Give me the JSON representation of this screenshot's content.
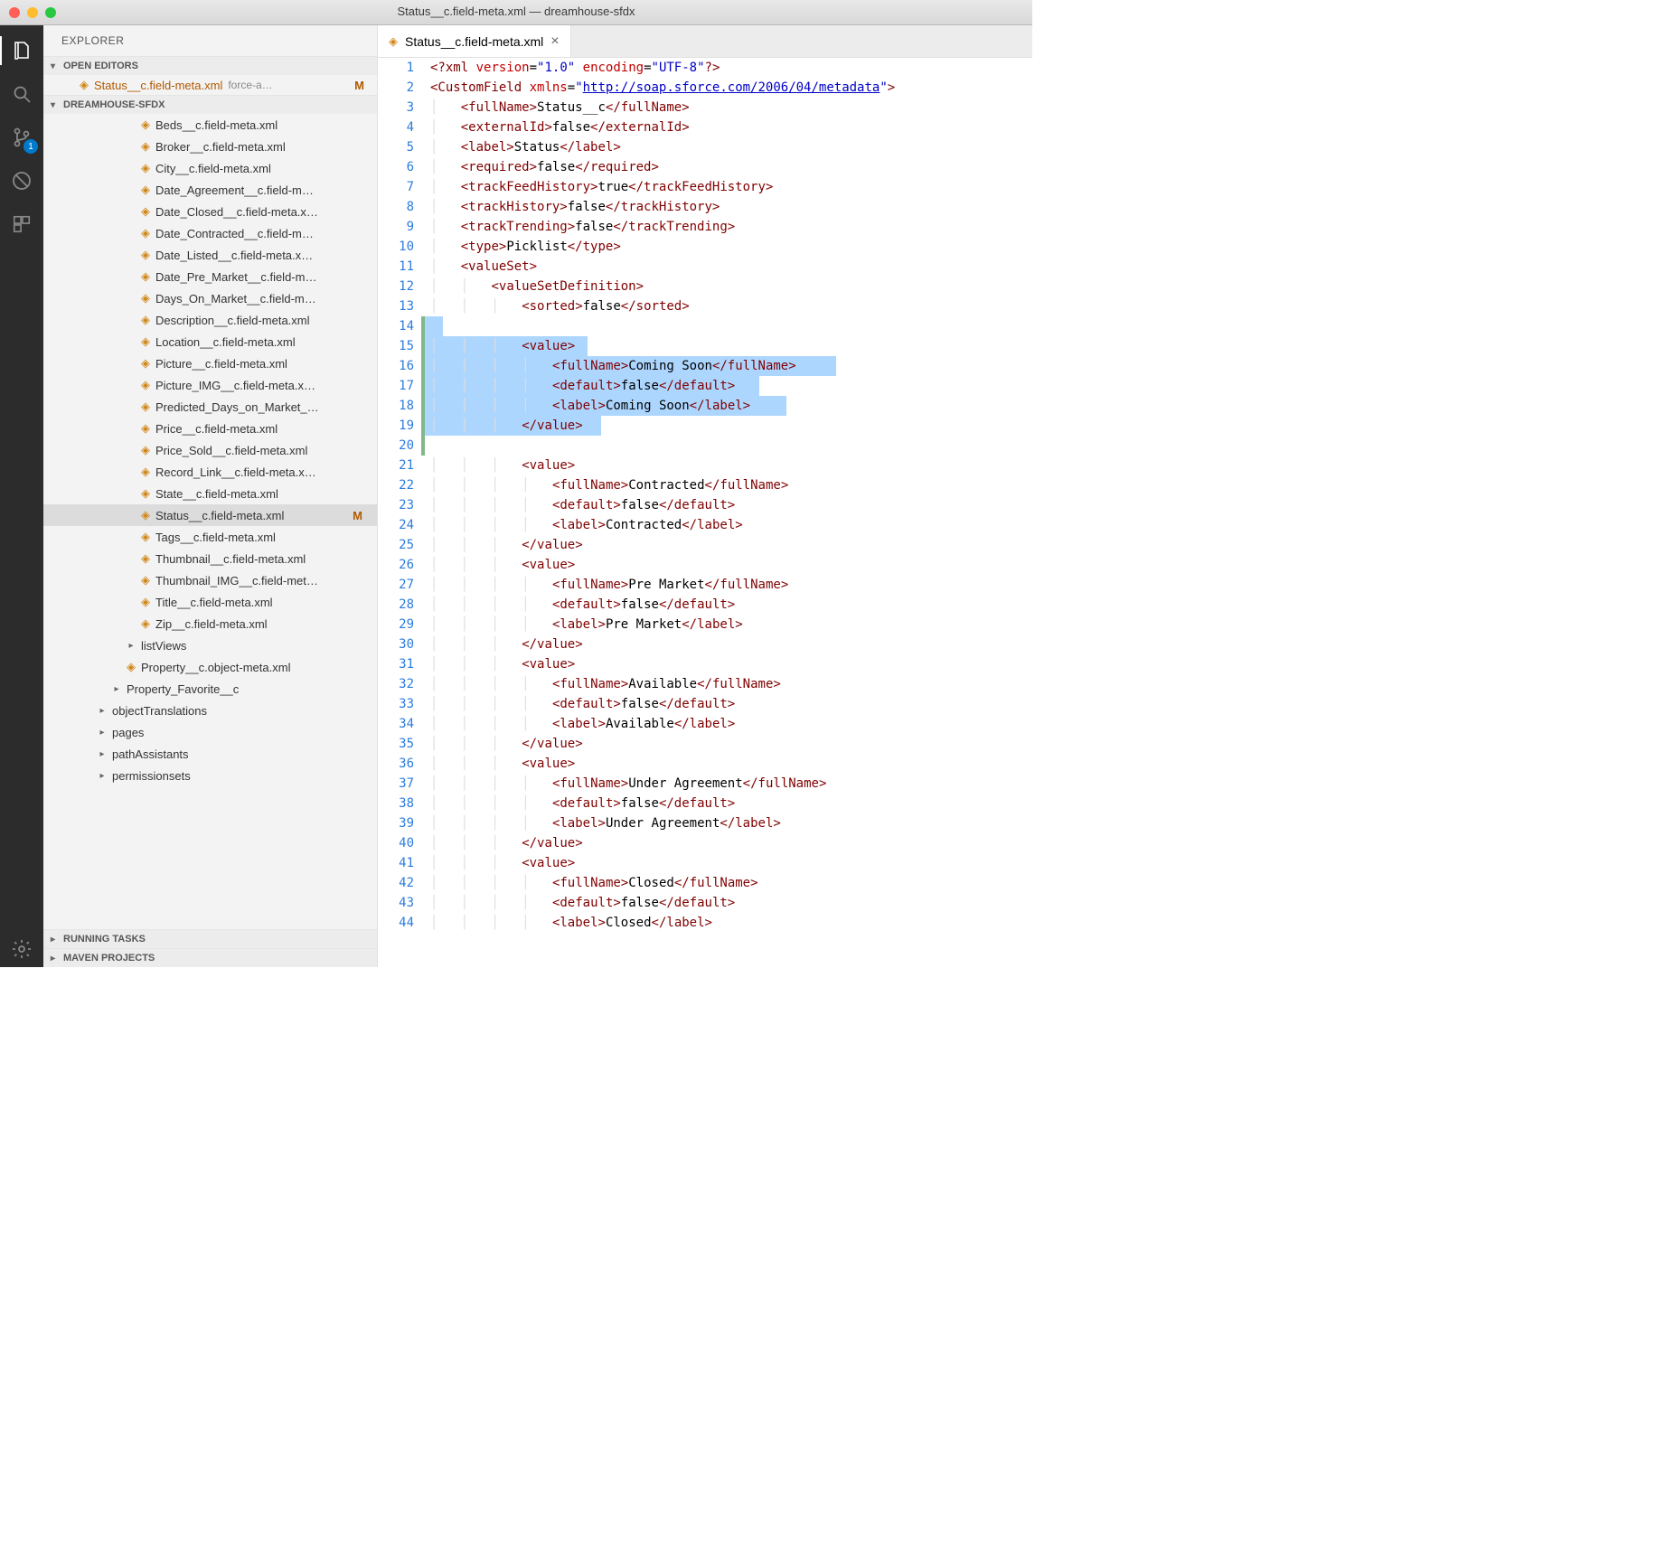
{
  "window": {
    "title": "Status__c.field-meta.xml — dreamhouse-sfdx"
  },
  "sidebar": {
    "title": "EXPLORER",
    "openEditors": {
      "label": "OPEN EDITORS",
      "items": [
        {
          "name": "Status__c.field-meta.xml",
          "dim": "force-a…",
          "mod": "M"
        }
      ]
    },
    "workspace": {
      "label": "DREAMHOUSE-SFDX",
      "files": [
        "Beds__c.field-meta.xml",
        "Broker__c.field-meta.xml",
        "City__c.field-meta.xml",
        "Date_Agreement__c.field-m…",
        "Date_Closed__c.field-meta.x…",
        "Date_Contracted__c.field-m…",
        "Date_Listed__c.field-meta.x…",
        "Date_Pre_Market__c.field-m…",
        "Days_On_Market__c.field-m…",
        "Description__c.field-meta.xml",
        "Location__c.field-meta.xml",
        "Picture__c.field-meta.xml",
        "Picture_IMG__c.field-meta.x…",
        "Predicted_Days_on_Market_…",
        "Price__c.field-meta.xml",
        "Price_Sold__c.field-meta.xml",
        "Record_Link__c.field-meta.x…",
        "State__c.field-meta.xml"
      ],
      "selectedFile": {
        "name": "Status__c.field-meta.xml",
        "mod": "M"
      },
      "filesAfter": [
        "Tags__c.field-meta.xml",
        "Thumbnail__c.field-meta.xml",
        "Thumbnail_IMG__c.field-met…",
        "Title__c.field-meta.xml",
        "Zip__c.field-meta.xml"
      ],
      "folders": [
        "listViews"
      ],
      "objectMeta": "Property__c.object-meta.xml",
      "folders2": [
        "Property_Favorite__c",
        "objectTranslations",
        "pages",
        "pathAssistants",
        "permissionsets"
      ]
    },
    "bottomSections": [
      "RUNNING TASKS",
      "MAVEN PROJECTS"
    ]
  },
  "scm": {
    "badge": "1"
  },
  "tab": {
    "name": "Status__c.field-meta.xml"
  },
  "code": {
    "diffStart": 14,
    "diffEnd": 20,
    "highlightStart": 14,
    "highlightEnd": 19,
    "xmlns_url": "http://soap.sforce.com/2006/04/metadata",
    "fields": {
      "fullName": "Status__c",
      "externalId": "false",
      "label": "Status",
      "required": "false",
      "trackFeedHistory": "true",
      "trackHistory": "false",
      "trackTrending": "false",
      "type": "Picklist",
      "sorted": "false"
    },
    "values": [
      {
        "fullName": "Coming Soon",
        "default": "false",
        "label": "Coming Soon"
      },
      {
        "fullName": "Contracted",
        "default": "false",
        "label": "Contracted"
      },
      {
        "fullName": "Pre Market",
        "default": "false",
        "label": "Pre Market"
      },
      {
        "fullName": "Available",
        "default": "false",
        "label": "Available"
      },
      {
        "fullName": "Under Agreement",
        "default": "false",
        "label": "Under Agreement"
      },
      {
        "fullName": "Closed",
        "default": "false",
        "label": "Closed"
      }
    ]
  }
}
